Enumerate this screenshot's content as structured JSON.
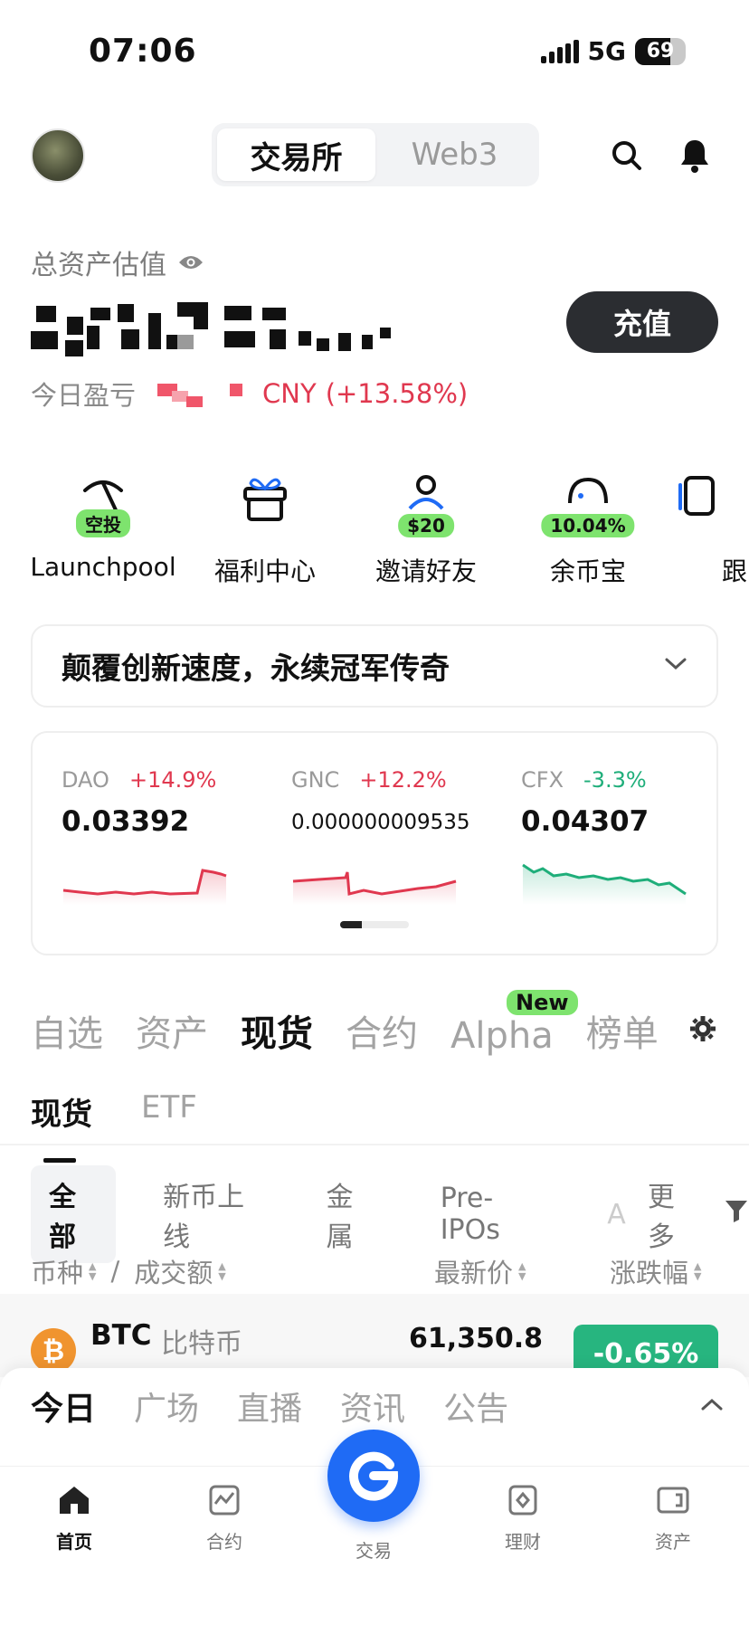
{
  "status": {
    "time": "07:06",
    "network": "5G",
    "battery": "69",
    "battery_level": 0.69
  },
  "header": {
    "tabs": [
      "交易所",
      "Web3"
    ],
    "active_tab": 0
  },
  "assets": {
    "label": "总资产估值",
    "pl_label": "今日盈亏",
    "pl_currency": "CNY",
    "pl_percent": "(+13.58%)",
    "deposit_label": "充值"
  },
  "quick_actions": [
    {
      "label": "Launchpool",
      "badge": "空投",
      "icon": "pickaxe-icon"
    },
    {
      "label": "福利中心",
      "badge": "",
      "icon": "gift-icon"
    },
    {
      "label": "邀请好友",
      "badge": "$20",
      "icon": "invite-user-icon"
    },
    {
      "label": "余币宝",
      "badge": "10.04%",
      "icon": "piggy-icon"
    },
    {
      "label": "跟",
      "badge": "",
      "icon": "copy-trade-icon"
    }
  ],
  "banner": {
    "text": "颠覆创新速度，永续冠军传奇"
  },
  "tickers": [
    {
      "symbol": "DAO",
      "change": "+14.9%",
      "price": "0.03392",
      "trend": "up"
    },
    {
      "symbol": "GNC",
      "change": "+12.2%",
      "price": "0.000000009535",
      "trend": "up"
    },
    {
      "symbol": "CFX",
      "change": "-3.3%",
      "price": "0.04307",
      "trend": "down"
    }
  ],
  "market_tabs": [
    "自选",
    "资产",
    "现货",
    "合约",
    "Alpha",
    "榜单"
  ],
  "market_active": 2,
  "alpha_badge": "New",
  "sub_tabs": [
    "现货",
    "ETF"
  ],
  "chips": [
    "全部",
    "新币上线",
    "金属",
    "Pre-IPOs",
    "A",
    "更多"
  ],
  "columns": {
    "coin": "币种",
    "sep": "/",
    "volume": "成交额",
    "price": "最新价",
    "change": "涨跌幅"
  },
  "coin": {
    "symbol": "BTC",
    "name": "比特币",
    "price": "61,350.8",
    "change": "-0.65%"
  },
  "news_tabs": [
    "今日",
    "广场",
    "直播",
    "资讯",
    "公告"
  ],
  "bottom_nav": [
    "首页",
    "合约",
    "交易",
    "理财",
    "资产"
  ],
  "colors": {
    "up": "#e0384f",
    "down": "#1fae7a",
    "accent": "#1f6bf5",
    "badge": "#7ee36e"
  }
}
